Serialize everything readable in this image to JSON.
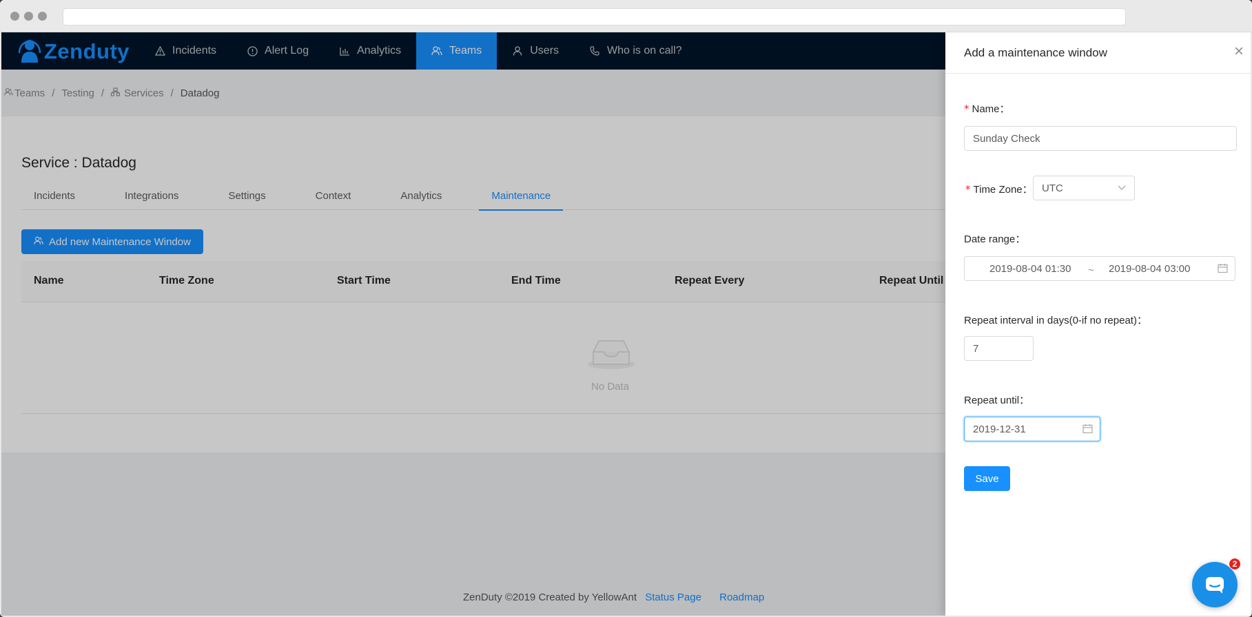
{
  "app": {
    "logo_text": "Zenduty"
  },
  "nav": {
    "items": [
      {
        "label": "Incidents",
        "icon": "warning-icon"
      },
      {
        "label": "Alert Log",
        "icon": "info-circle-icon"
      },
      {
        "label": "Analytics",
        "icon": "bar-chart-icon"
      },
      {
        "label": "Teams",
        "icon": "team-icon",
        "active": true
      },
      {
        "label": "Users",
        "icon": "user-icon"
      },
      {
        "label": "Who is on call?",
        "icon": "phone-icon"
      }
    ]
  },
  "breadcrumb": {
    "items": [
      "Teams",
      "Testing",
      "Services",
      "Datadog"
    ],
    "separator": "/"
  },
  "service": {
    "title": "Service : Datadog"
  },
  "tabs": [
    "Incidents",
    "Integrations",
    "Settings",
    "Context",
    "Analytics",
    "Maintenance"
  ],
  "active_tab": "Maintenance",
  "add_button_label": "Add new Maintenance Window",
  "table": {
    "columns": [
      "Name",
      "Time Zone",
      "Start Time",
      "End Time",
      "Repeat Every",
      "Repeat Until"
    ],
    "empty_text": "No Data"
  },
  "footer": {
    "text": "ZenDuty ©2019 Created by YellowAnt",
    "status_link": "Status Page",
    "roadmap_link": "Roadmap"
  },
  "drawer": {
    "title": "Add a maintenance window",
    "close_glyph": "×",
    "name_label": "Name：",
    "name_value": "Sunday Check",
    "timezone_label": "Time Zone：",
    "timezone_value": "UTC",
    "date_range_label": "Date range：",
    "date_start": "2019-08-04 01:30",
    "date_sep": "~",
    "date_end": "2019-08-04 03:00",
    "repeat_interval_label": "Repeat interval in days(0-if no repeat)：",
    "repeat_interval_value": "7",
    "repeat_until_label": "Repeat until：",
    "repeat_until_value": "2019-12-31",
    "save_label": "Save"
  },
  "chat": {
    "badge_count": "2"
  },
  "colors": {
    "primary": "#1890ff",
    "nav_bg": "#001529",
    "required": "#f5222d"
  }
}
